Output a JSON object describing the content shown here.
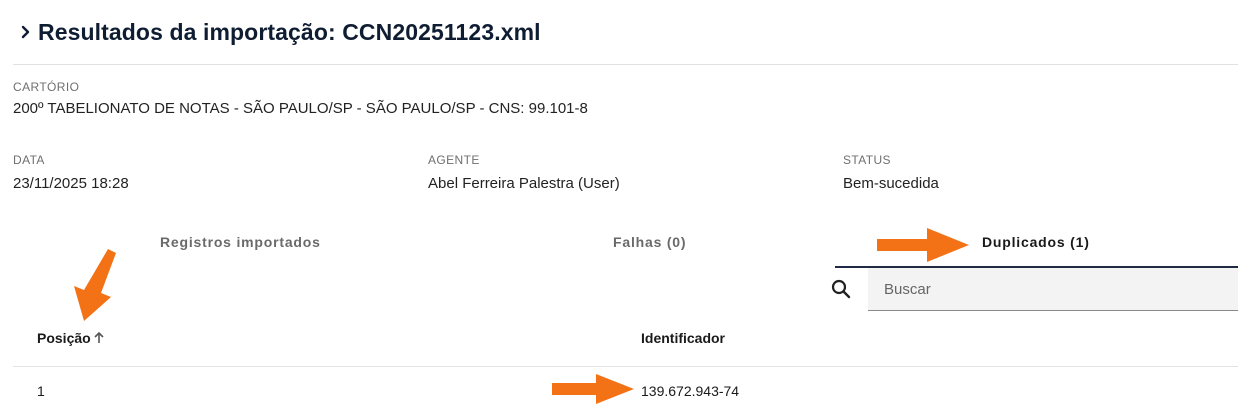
{
  "header": {
    "title": "Resultados da importação: CCN20251123.xml",
    "icon": "chevron-right-icon"
  },
  "cartorio": {
    "label": "CARTÓRIO",
    "value": "200º TABELIONATO DE NOTAS - SÃO PAULO/SP - SÃO PAULO/SP - CNS: 99.101-8"
  },
  "info": {
    "data_label": "DATA",
    "data_value": "23/11/2025 18:28",
    "agente_label": "AGENTE",
    "agente_value": "Abel Ferreira Palestra (User)",
    "status_label": "STATUS",
    "status_value": "Bem-sucedida"
  },
  "tabs": [
    {
      "label": "Registros importados",
      "active": false
    },
    {
      "label": "Falhas (0)",
      "active": false
    },
    {
      "label": "Duplicados (1)",
      "active": true
    }
  ],
  "search": {
    "placeholder": "Buscar",
    "value": "",
    "icon": "search-icon"
  },
  "table": {
    "columns": [
      "Posição",
      "Identificador"
    ],
    "sort_icon": "arrow-up-icon",
    "rows": [
      {
        "posicao": "1",
        "identificador": "139.672.943-74"
      }
    ]
  },
  "colors": {
    "title": "#0f1d33",
    "tab_underline": "#1f2a44",
    "annotation_arrow": "#f47216"
  }
}
